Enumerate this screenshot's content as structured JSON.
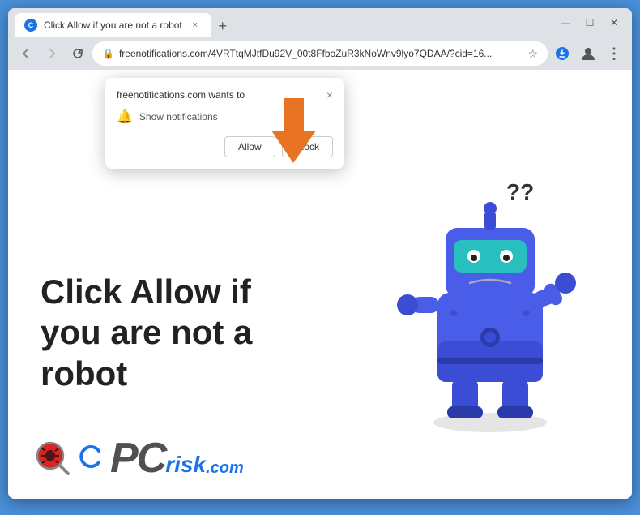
{
  "browser": {
    "tab": {
      "title": "Click Allow if you are not a robot",
      "favicon": "C",
      "close_label": "×"
    },
    "new_tab_label": "+",
    "window_controls": {
      "minimize": "—",
      "maximize": "☐",
      "close": "✕"
    },
    "toolbar": {
      "back_label": "←",
      "forward_label": "→",
      "reload_label": "↻",
      "url": "freenotifications.com/4VRTtqMJtfDu92V_00t8FfboZuR3kNoWnv9lyo7QDAA/?cid=16...",
      "star_label": "☆",
      "profile_label": "👤",
      "menu_label": "⋮",
      "download_label": "⬇"
    }
  },
  "notification_popup": {
    "title": "freenotifications.com wants to",
    "close_label": "×",
    "notification_text": "Show notifications",
    "allow_label": "Allow",
    "block_label": "Block"
  },
  "page": {
    "heading_line1": "Click Allow if",
    "heading_line2": "you are not a",
    "heading_line3": "robot"
  },
  "branding": {
    "c_label": "C",
    "pc_label": "PC",
    "risk_label": "risk",
    "dot_com": ".com"
  },
  "colors": {
    "robot_body": "#4a5de8",
    "robot_visor": "#2abfbf",
    "robot_dark": "#2a3aaa",
    "robot_belly": "#6070ee",
    "accent_blue": "#1a73e8"
  }
}
